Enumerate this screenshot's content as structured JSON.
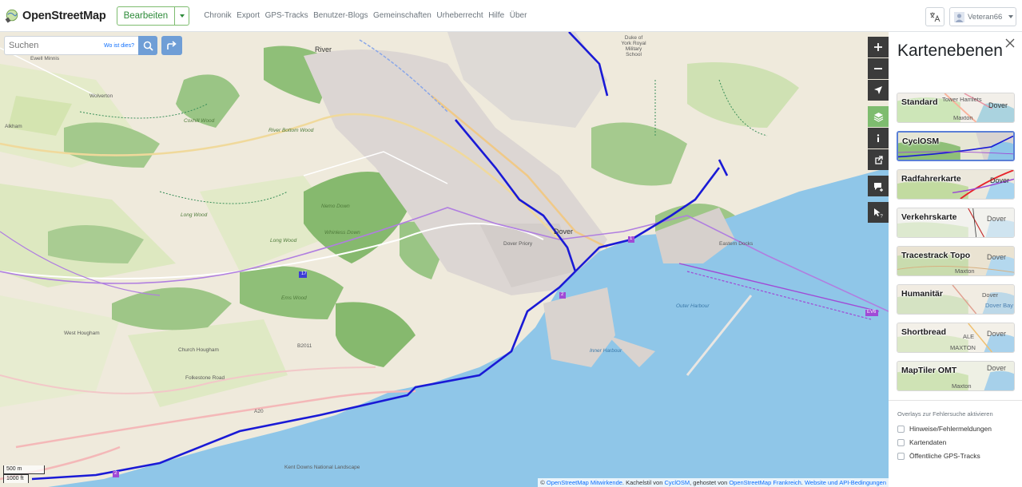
{
  "header": {
    "logo_text": "OpenStreetMap",
    "edit_label": "Bearbeiten",
    "nav": [
      "Chronik",
      "Export",
      "GPS-Tracks",
      "Benutzer-Blogs",
      "Gemeinschaften",
      "Urheberrecht",
      "Hilfe",
      "Über"
    ],
    "username": "Veteran66"
  },
  "search": {
    "placeholder": "Suchen",
    "where_label": "Wo ist dies?"
  },
  "map": {
    "labels": {
      "ewell_minnis": "Ewell Minnis",
      "wolverton": "Wolverton",
      "alkham": "Alkham",
      "river": "River",
      "coxhill_wood": "Coxhill Wood",
      "river_bottom_wood": "River Bottom Wood",
      "duke_of_york": "Duke of York Royal Military School",
      "tower_hamlets": "Tower Hamlets",
      "long_wood": "Long Wood",
      "nemo_down": "Nemo Down",
      "whinless_down": "Whinless Down",
      "dover": "Dover",
      "dover_priory": "Dover Priory",
      "ems_wood": "Ems Wood",
      "west_hougham": "West Hougham",
      "church_hougham": "Church Hougham",
      "outer_harbour": "Outer Harbour",
      "inner_harbour": "Inner Harbour",
      "eastern_docks": "Eastern Docks",
      "folkestone_road": "Folkestone Road",
      "kent_downs": "Kent Downs National Landscape",
      "a20": "A20",
      "b2011": "B2011",
      "route_17": "17",
      "route_1": "1",
      "route_2": "2",
      "route_2b": "2",
      "ev6": "EV6"
    },
    "scale": {
      "metric": "500 m",
      "imperial": "1000 ft"
    },
    "attribution": {
      "prefix": "© ",
      "osm": "OpenStreetMap Mitwirkende",
      "tile_style_pre": ". Kachelstil von ",
      "cyclosm": "CyclOSM",
      "hosted_pre": ", gehostet von ",
      "osm_fr": "OpenStreetMap Frankreich",
      "sep": ". ",
      "terms": "Website und API-Bedingungen"
    }
  },
  "map_controls": [
    "zoom-in",
    "zoom-out",
    "locate",
    "layers",
    "info",
    "share",
    "note",
    "query"
  ],
  "sidebar": {
    "title": "Kartenebenen",
    "layers": [
      {
        "name": "Standard",
        "labels": [
          "Tower Hamlets",
          "Dover",
          "Maxton"
        ]
      },
      {
        "name": "CyclOSM",
        "labels": []
      },
      {
        "name": "Radfahrerkarte",
        "labels": [
          "Dover"
        ]
      },
      {
        "name": "Verkehrskarte",
        "labels": [
          "Dover"
        ]
      },
      {
        "name": "Tracestrack Topo",
        "labels": [
          "Dover",
          "Maxton"
        ]
      },
      {
        "name": "Humanitär",
        "labels": [
          "Dover",
          "Dover Bay"
        ]
      },
      {
        "name": "Shortbread",
        "labels": [
          "Dover",
          "ALE",
          "MAXTON"
        ]
      },
      {
        "name": "MapTiler OMT",
        "labels": [
          "Dover",
          "Maxton"
        ]
      }
    ],
    "selected_layer": "CyclOSM",
    "overlays_title": "Overlays zur Fehlersuche aktivieren",
    "overlays": [
      "Hinweise/Fehlermeldungen",
      "Kartendaten",
      "Öffentliche GPS-Tracks"
    ]
  },
  "colors": {
    "brand_green": "#7ebc6f",
    "sea": "#8fc6e8",
    "cycle_route": "#1a1ad6",
    "selected_border": "#5a7fd6"
  }
}
